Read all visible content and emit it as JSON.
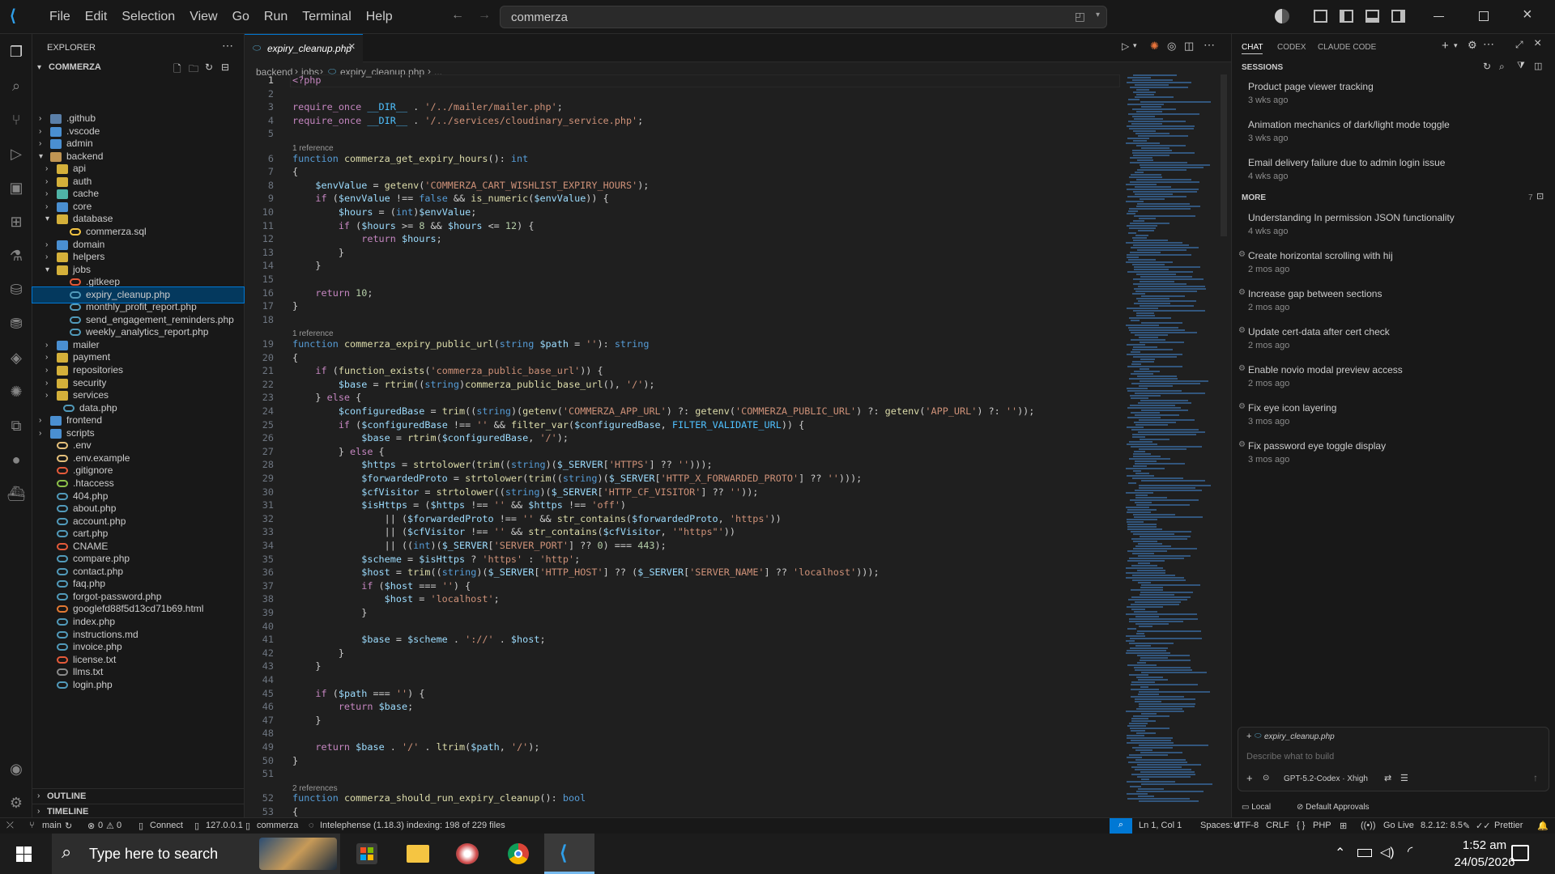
{
  "titlebar": {
    "menu": [
      "File",
      "Edit",
      "Selection",
      "View",
      "Go",
      "Run",
      "Terminal",
      "Help"
    ],
    "search": "commerza"
  },
  "explorer": {
    "title": "EXPLORER",
    "root": "COMMERZA",
    "items": [
      {
        "label": ".github",
        "depth": 1,
        "kind": "folder",
        "open": false
      },
      {
        "label": ".vscode",
        "depth": 1,
        "kind": "folder",
        "open": false
      },
      {
        "label": "admin",
        "depth": 1,
        "kind": "folder",
        "open": false
      },
      {
        "label": "backend",
        "depth": 1,
        "kind": "folder",
        "open": true
      },
      {
        "label": "api",
        "depth": 2,
        "kind": "folder",
        "open": false
      },
      {
        "label": "auth",
        "depth": 2,
        "kind": "folder",
        "open": false
      },
      {
        "label": "cache",
        "depth": 2,
        "kind": "folder",
        "open": false
      },
      {
        "label": "core",
        "depth": 2,
        "kind": "folder",
        "open": false
      },
      {
        "label": "database",
        "depth": 2,
        "kind": "folder",
        "open": true
      },
      {
        "label": "commerza.sql",
        "depth": 3,
        "kind": "sql"
      },
      {
        "label": "domain",
        "depth": 2,
        "kind": "folder",
        "open": false
      },
      {
        "label": "helpers",
        "depth": 2,
        "kind": "folder",
        "open": false
      },
      {
        "label": "jobs",
        "depth": 2,
        "kind": "folder",
        "open": true
      },
      {
        "label": ".gitkeep",
        "depth": 3,
        "kind": "git"
      },
      {
        "label": "expiry_cleanup.php",
        "depth": 3,
        "kind": "php",
        "selected": true
      },
      {
        "label": "monthly_profit_report.php",
        "depth": 3,
        "kind": "php"
      },
      {
        "label": "send_engagement_reminders.php",
        "depth": 3,
        "kind": "php"
      },
      {
        "label": "weekly_analytics_report.php",
        "depth": 3,
        "kind": "php"
      },
      {
        "label": "mailer",
        "depth": 2,
        "kind": "folder",
        "open": false
      },
      {
        "label": "payment",
        "depth": 2,
        "kind": "folder",
        "open": false
      },
      {
        "label": "repositories",
        "depth": 2,
        "kind": "folder",
        "open": false
      },
      {
        "label": "security",
        "depth": 2,
        "kind": "folder",
        "open": false
      },
      {
        "label": "services",
        "depth": 2,
        "kind": "folder",
        "open": false
      },
      {
        "label": "data.php",
        "depth": 2,
        "kind": "php"
      },
      {
        "label": "frontend",
        "depth": 1,
        "kind": "folder",
        "open": false
      },
      {
        "label": "scripts",
        "depth": 1,
        "kind": "folder",
        "open": false
      },
      {
        "label": ".env",
        "depth": 1,
        "kind": "env"
      },
      {
        "label": ".env.example",
        "depth": 1,
        "kind": "env"
      },
      {
        "label": ".gitignore",
        "depth": 1,
        "kind": "git"
      },
      {
        "label": ".htaccess",
        "depth": 1,
        "kind": "ht"
      },
      {
        "label": "404.php",
        "depth": 1,
        "kind": "php"
      },
      {
        "label": "about.php",
        "depth": 1,
        "kind": "php"
      },
      {
        "label": "account.php",
        "depth": 1,
        "kind": "php"
      },
      {
        "label": "cart.php",
        "depth": 1,
        "kind": "php"
      },
      {
        "label": "CNAME",
        "depth": 1,
        "kind": "cname"
      },
      {
        "label": "compare.php",
        "depth": 1,
        "kind": "php"
      },
      {
        "label": "contact.php",
        "depth": 1,
        "kind": "php"
      },
      {
        "label": "faq.php",
        "depth": 1,
        "kind": "php"
      },
      {
        "label": "forgot-password.php",
        "depth": 1,
        "kind": "php"
      },
      {
        "label": "googlefd88f5d13cd71b69.html",
        "depth": 1,
        "kind": "html"
      },
      {
        "label": "index.php",
        "depth": 1,
        "kind": "php"
      },
      {
        "label": "instructions.md",
        "depth": 1,
        "kind": "md"
      },
      {
        "label": "invoice.php",
        "depth": 1,
        "kind": "php"
      },
      {
        "label": "license.txt",
        "depth": 1,
        "kind": "lic"
      },
      {
        "label": "llms.txt",
        "depth": 1,
        "kind": "txt"
      },
      {
        "label": "login.php",
        "depth": 1,
        "kind": "php"
      }
    ],
    "outline": "OUTLINE",
    "timeline": "TIMELINE"
  },
  "editor": {
    "tab": "expiry_cleanup.php",
    "breadcrumb": [
      "backend",
      "jobs",
      "expiry_cleanup.php",
      "..."
    ]
  },
  "code": [
    {
      "n": "1",
      "h": "<span class='pk'>&lt;?php</span>"
    },
    {
      "n": "2",
      "h": ""
    },
    {
      "n": "3",
      "h": "<span class='pk'>require_once</span> <span class='ct'>__DIR__</span> . <span class='st'>'/../mailer/mailer.php'</span>;"
    },
    {
      "n": "4",
      "h": "<span class='pk'>require_once</span> <span class='ct'>__DIR__</span> . <span class='st'>'/../services/cloudinary_service.php'</span>;"
    },
    {
      "n": "5",
      "h": ""
    },
    {
      "c": "1 reference"
    },
    {
      "n": "6",
      "h": "<span class='kw'>function</span> <span class='fn'>commerza_get_expiry_hours</span>(): <span class='kw'>int</span>"
    },
    {
      "n": "7",
      "h": "{"
    },
    {
      "n": "8",
      "h": "    <span class='vr'>$envValue</span> = <span class='fn'>getenv</span>(<span class='st'>'COMMERZA_CART_WISHLIST_EXPIRY_HOURS'</span>);"
    },
    {
      "n": "9",
      "h": "    <span class='pk'>if</span> (<span class='vr'>$envValue</span> !== <span class='kw'>false</span> &amp;&amp; <span class='fn'>is_numeric</span>(<span class='vr'>$envValue</span>)) {"
    },
    {
      "n": "10",
      "h": "        <span class='vr'>$hours</span> = (<span class='kw'>int</span>)<span class='vr'>$envValue</span>;"
    },
    {
      "n": "11",
      "h": "        <span class='pk'>if</span> (<span class='vr'>$hours</span> &gt;= <span class='nm'>8</span> &amp;&amp; <span class='vr'>$hours</span> &lt;= <span class='nm'>12</span>) {"
    },
    {
      "n": "12",
      "h": "            <span class='pk'>return</span> <span class='vr'>$hours</span>;"
    },
    {
      "n": "13",
      "h": "        }"
    },
    {
      "n": "14",
      "h": "    }"
    },
    {
      "n": "15",
      "h": ""
    },
    {
      "n": "16",
      "h": "    <span class='pk'>return</span> <span class='nm'>10</span>;"
    },
    {
      "n": "17",
      "h": "}"
    },
    {
      "n": "18",
      "h": ""
    },
    {
      "c": "1 reference"
    },
    {
      "n": "19",
      "h": "<span class='kw'>function</span> <span class='fn'>commerza_expiry_public_url</span>(<span class='kw'>string</span> <span class='vr'>$path</span> = <span class='st'>''</span>): <span class='kw'>string</span>"
    },
    {
      "n": "20",
      "h": "{"
    },
    {
      "n": "21",
      "h": "    <span class='pk'>if</span> (<span class='fn'>function_exists</span>(<span class='st'>'commerza_public_base_url'</span>)) {"
    },
    {
      "n": "22",
      "h": "        <span class='vr'>$base</span> = <span class='fn'>rtrim</span>((<span class='kw'>string</span>)<span class='fn'>commerza_public_base_url</span>(), <span class='st'>'/'</span>);"
    },
    {
      "n": "23",
      "h": "    } <span class='pk'>else</span> {"
    },
    {
      "n": "24",
      "h": "        <span class='vr'>$configuredBase</span> = <span class='fn'>trim</span>((<span class='kw'>string</span>)(<span class='fn'>getenv</span>(<span class='st'>'COMMERZA_APP_URL'</span>) ?: <span class='fn'>getenv</span>(<span class='st'>'COMMERZA_PUBLIC_URL'</span>) ?: <span class='fn'>getenv</span>(<span class='st'>'APP_URL'</span>) ?: <span class='st'>''</span>));"
    },
    {
      "n": "25",
      "h": "        <span class='pk'>if</span> (<span class='vr'>$configuredBase</span> !== <span class='st'>''</span> &amp;&amp; <span class='fn'>filter_var</span>(<span class='vr'>$configuredBase</span>, <span class='ct'>FILTER_VALIDATE_URL</span>)) {"
    },
    {
      "n": "26",
      "h": "            <span class='vr'>$base</span> = <span class='fn'>rtrim</span>(<span class='vr'>$configuredBase</span>, <span class='st'>'/'</span>);"
    },
    {
      "n": "27",
      "h": "        } <span class='pk'>else</span> {"
    },
    {
      "n": "28",
      "h": "            <span class='vr'>$https</span> = <span class='fn'>strtolower</span>(<span class='fn'>trim</span>((<span class='kw'>string</span>)(<span class='vr'>$_SERVER</span>[<span class='st'>'HTTPS'</span>] ?? <span class='st'>''</span>)));"
    },
    {
      "n": "29",
      "h": "            <span class='vr'>$forwardedProto</span> = <span class='fn'>strtolower</span>(<span class='fn'>trim</span>((<span class='kw'>string</span>)(<span class='vr'>$_SERVER</span>[<span class='st'>'HTTP_X_FORWARDED_PROTO'</span>] ?? <span class='st'>''</span>)));"
    },
    {
      "n": "30",
      "h": "            <span class='vr'>$cfVisitor</span> = <span class='fn'>strtolower</span>((<span class='kw'>string</span>)(<span class='vr'>$_SERVER</span>[<span class='st'>'HTTP_CF_VISITOR'</span>] ?? <span class='st'>''</span>));"
    },
    {
      "n": "31",
      "h": "            <span class='vr'>$isHttps</span> = (<span class='vr'>$https</span> !== <span class='st'>''</span> &amp;&amp; <span class='vr'>$https</span> !== <span class='st'>'off'</span>)"
    },
    {
      "n": "32",
      "h": "                || (<span class='vr'>$forwardedProto</span> !== <span class='st'>''</span> &amp;&amp; <span class='fn'>str_contains</span>(<span class='vr'>$forwardedProto</span>, <span class='st'>'https'</span>))"
    },
    {
      "n": "33",
      "h": "                || (<span class='vr'>$cfVisitor</span> !== <span class='st'>''</span> &amp;&amp; <span class='fn'>str_contains</span>(<span class='vr'>$cfVisitor</span>, <span class='st'>'\"https\"'</span>))"
    },
    {
      "n": "34",
      "h": "                || ((<span class='kw'>int</span>)(<span class='vr'>$_SERVER</span>[<span class='st'>'SERVER_PORT'</span>] ?? <span class='nm'>0</span>) === <span class='nm'>443</span>);"
    },
    {
      "n": "35",
      "h": "            <span class='vr'>$scheme</span> = <span class='vr'>$isHttps</span> ? <span class='st'>'https'</span> : <span class='st'>'http'</span>;"
    },
    {
      "n": "36",
      "h": "            <span class='vr'>$host</span> = <span class='fn'>trim</span>((<span class='kw'>string</span>)(<span class='vr'>$_SERVER</span>[<span class='st'>'HTTP_HOST'</span>] ?? (<span class='vr'>$_SERVER</span>[<span class='st'>'SERVER_NAME'</span>] ?? <span class='st'>'localhost'</span>)));"
    },
    {
      "n": "37",
      "h": "            <span class='pk'>if</span> (<span class='vr'>$host</span> === <span class='st'>''</span>) {"
    },
    {
      "n": "38",
      "h": "                <span class='vr'>$host</span> = <span class='st'>'localhost'</span>;"
    },
    {
      "n": "39",
      "h": "            }"
    },
    {
      "n": "40",
      "h": ""
    },
    {
      "n": "41",
      "h": "            <span class='vr'>$base</span> = <span class='vr'>$scheme</span> . <span class='st'>'://'</span> . <span class='vr'>$host</span>;"
    },
    {
      "n": "42",
      "h": "        }"
    },
    {
      "n": "43",
      "h": "    }"
    },
    {
      "n": "44",
      "h": ""
    },
    {
      "n": "45",
      "h": "    <span class='pk'>if</span> (<span class='vr'>$path</span> === <span class='st'>''</span>) {"
    },
    {
      "n": "46",
      "h": "        <span class='pk'>return</span> <span class='vr'>$base</span>;"
    },
    {
      "n": "47",
      "h": "    }"
    },
    {
      "n": "48",
      "h": ""
    },
    {
      "n": "49",
      "h": "    <span class='pk'>return</span> <span class='vr'>$base</span> . <span class='st'>'/'</span> . <span class='fn'>ltrim</span>(<span class='vr'>$path</span>, <span class='st'>'/'</span>);"
    },
    {
      "n": "50",
      "h": "}"
    },
    {
      "n": "51",
      "h": ""
    },
    {
      "c": "2 references"
    },
    {
      "n": "52",
      "h": "<span class='kw'>function</span> <span class='fn'>commerza_should_run_expiry_cleanup</span>(): <span class='kw'>bool</span>"
    },
    {
      "n": "53",
      "h": "{"
    }
  ],
  "chat": {
    "tabs": [
      "CHAT",
      "CODEX",
      "CLAUDE CODE"
    ],
    "sessions_title": "SESSIONS",
    "more_title": "MORE",
    "more_count": "7",
    "recent": [
      {
        "t": "Product page viewer tracking",
        "d": "3 wks ago"
      },
      {
        "t": "Animation mechanics of dark/light mode toggle",
        "d": "3 wks ago"
      },
      {
        "t": "Email delivery failure due to admin login issue",
        "d": "4 wks ago"
      }
    ],
    "more": [
      {
        "t": "Understanding In permission JSON functionality",
        "d": "4 wks ago"
      },
      {
        "t": "Create horizontal scrolling with hij",
        "d": "2 mos ago"
      },
      {
        "t": "Increase gap between sections",
        "d": "2 mos ago"
      },
      {
        "t": "Update cert-data after cert check",
        "d": "2 mos ago"
      },
      {
        "t": "Enable novio modal preview access",
        "d": "2 mos ago"
      },
      {
        "t": "Fix eye icon layering",
        "d": "3 mos ago"
      },
      {
        "t": "Fix password eye toggle display",
        "d": "3 mos ago"
      }
    ],
    "input_file": "expiry_cleanup.php",
    "input_placeholder": "Describe what to build",
    "model": "GPT-5.2-Codex · Xhigh",
    "local": "Local",
    "approvals": "Default Approvals"
  },
  "status": {
    "branch": "main",
    "problems": "0",
    "warnings": "0",
    "connect": "Connect",
    "ip": "127.0.0.1",
    "folder": "commerza",
    "indexing": "Intelephense (1.18.3) indexing: 198 of 229 files",
    "position": "Ln 1, Col 1",
    "spaces": "Spaces: 4",
    "encoding": "UTF-8",
    "eol": "CRLF",
    "lang": "PHP",
    "golive": "Go Live",
    "version": "8.2.12: 8.5",
    "prettier": "Prettier"
  },
  "taskbar": {
    "search": "Type here to search",
    "time": "1:52 am",
    "date": "24/05/2026"
  }
}
